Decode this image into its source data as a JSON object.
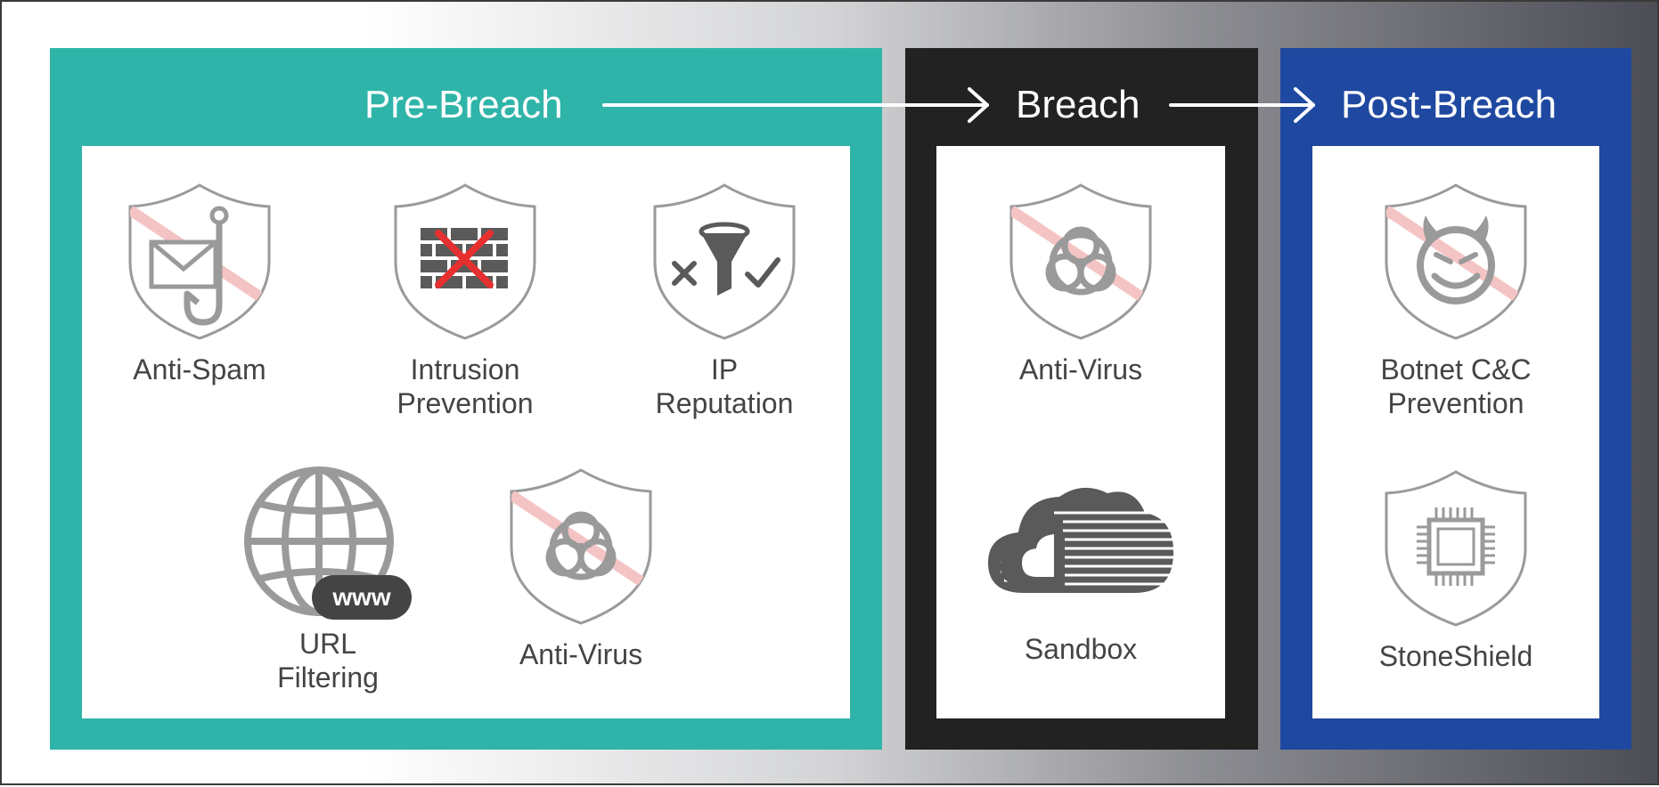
{
  "stages": {
    "pre_breach": {
      "title": "Pre-Breach",
      "color": "#2fb4a9",
      "items": [
        {
          "label": "Anti-Spam",
          "icon": "shield-mail-hook-icon"
        },
        {
          "label": "Intrusion\nPrevention",
          "icon": "shield-firewall-icon"
        },
        {
          "label": "IP\nReputation",
          "icon": "shield-filter-icon"
        },
        {
          "label": "URL\nFiltering",
          "icon": "globe-www-icon"
        },
        {
          "label": "Anti-Virus",
          "icon": "shield-biohazard-icon"
        }
      ],
      "www_badge": "www"
    },
    "breach": {
      "title": "Breach",
      "color": "#222222",
      "items": [
        {
          "label": "Anti-Virus",
          "icon": "shield-biohazard-icon"
        },
        {
          "label": "Sandbox",
          "icon": "cloud-icon"
        }
      ]
    },
    "post_breach": {
      "title": "Post-Breach",
      "color": "#1f48a0",
      "items": [
        {
          "label": "Botnet C&C\nPrevention",
          "icon": "shield-devil-icon"
        },
        {
          "label": "StoneShield",
          "icon": "shield-chip-icon"
        }
      ]
    }
  },
  "colors": {
    "icon_gray": "#9a9a9a",
    "strike": "#f4c4c4",
    "firewall_x": "#e63030",
    "label": "#444444"
  }
}
